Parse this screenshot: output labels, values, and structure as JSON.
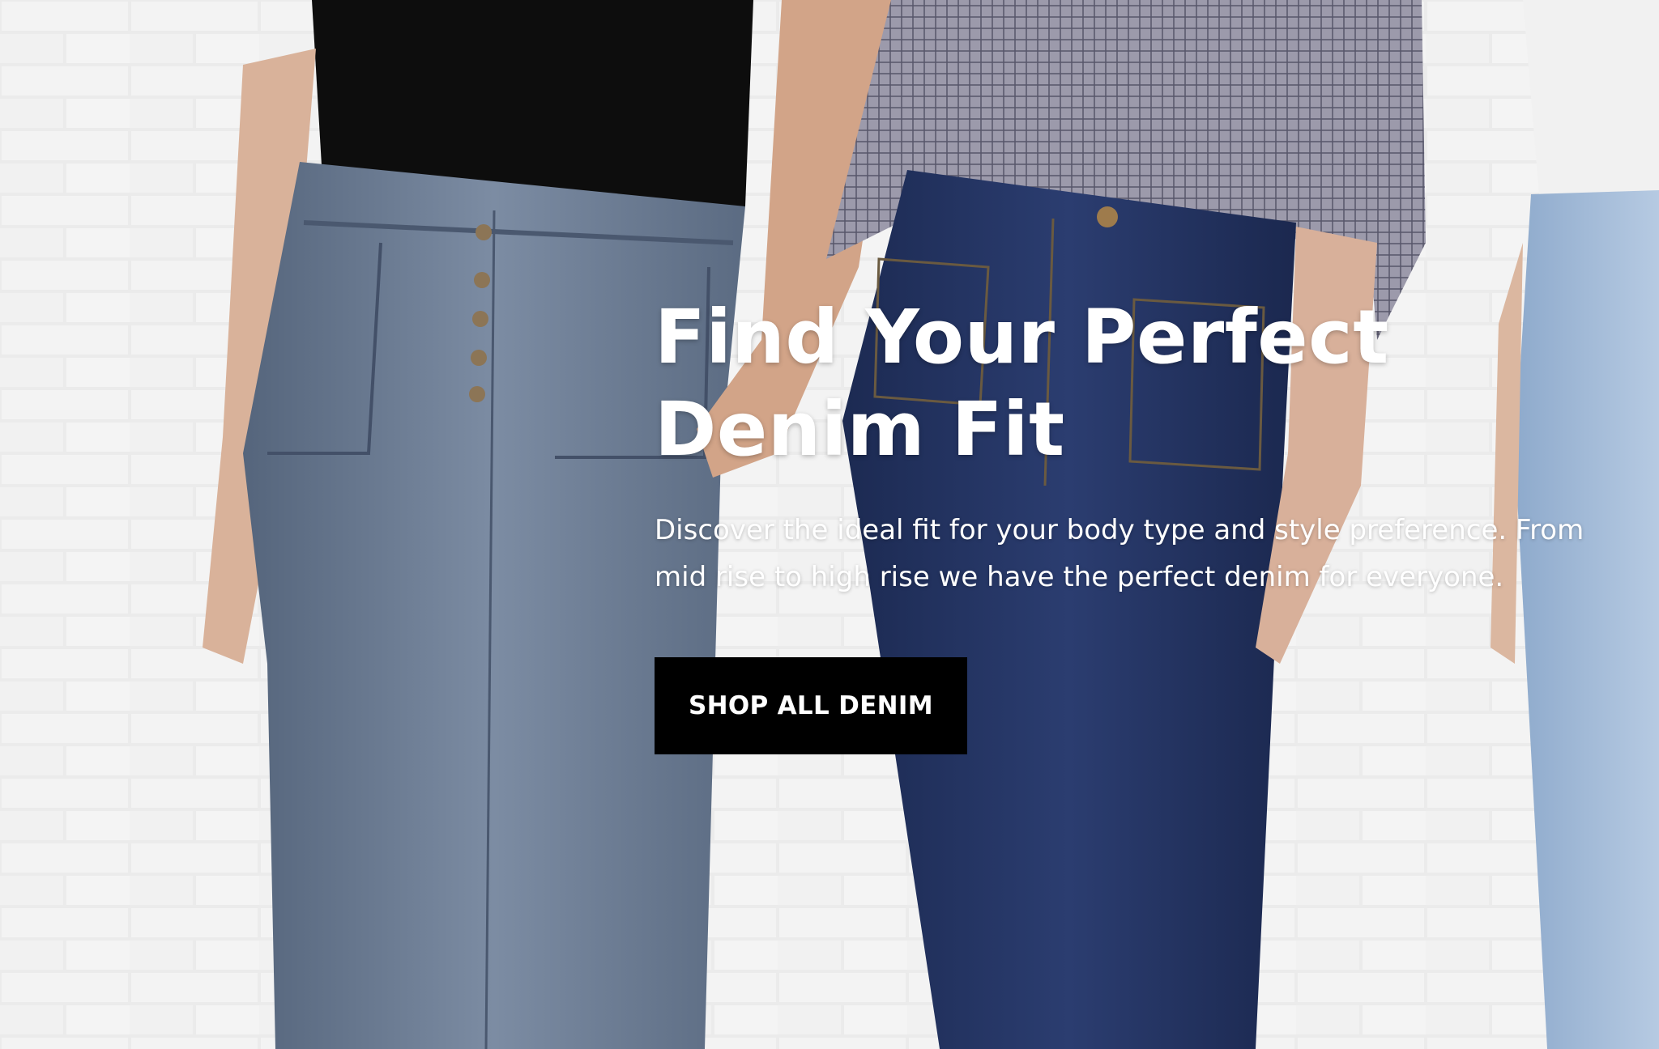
{
  "hero": {
    "title": "Find Your Perfect\nDenim Fit",
    "description": "Discover the ideal fit for your body type and style preference. From mid rise to high rise we have the perfect denim for everyone.",
    "cta_label": "SHOP ALL DENIM"
  },
  "colors": {
    "cta_background": "#000000",
    "text": "#ffffff"
  }
}
